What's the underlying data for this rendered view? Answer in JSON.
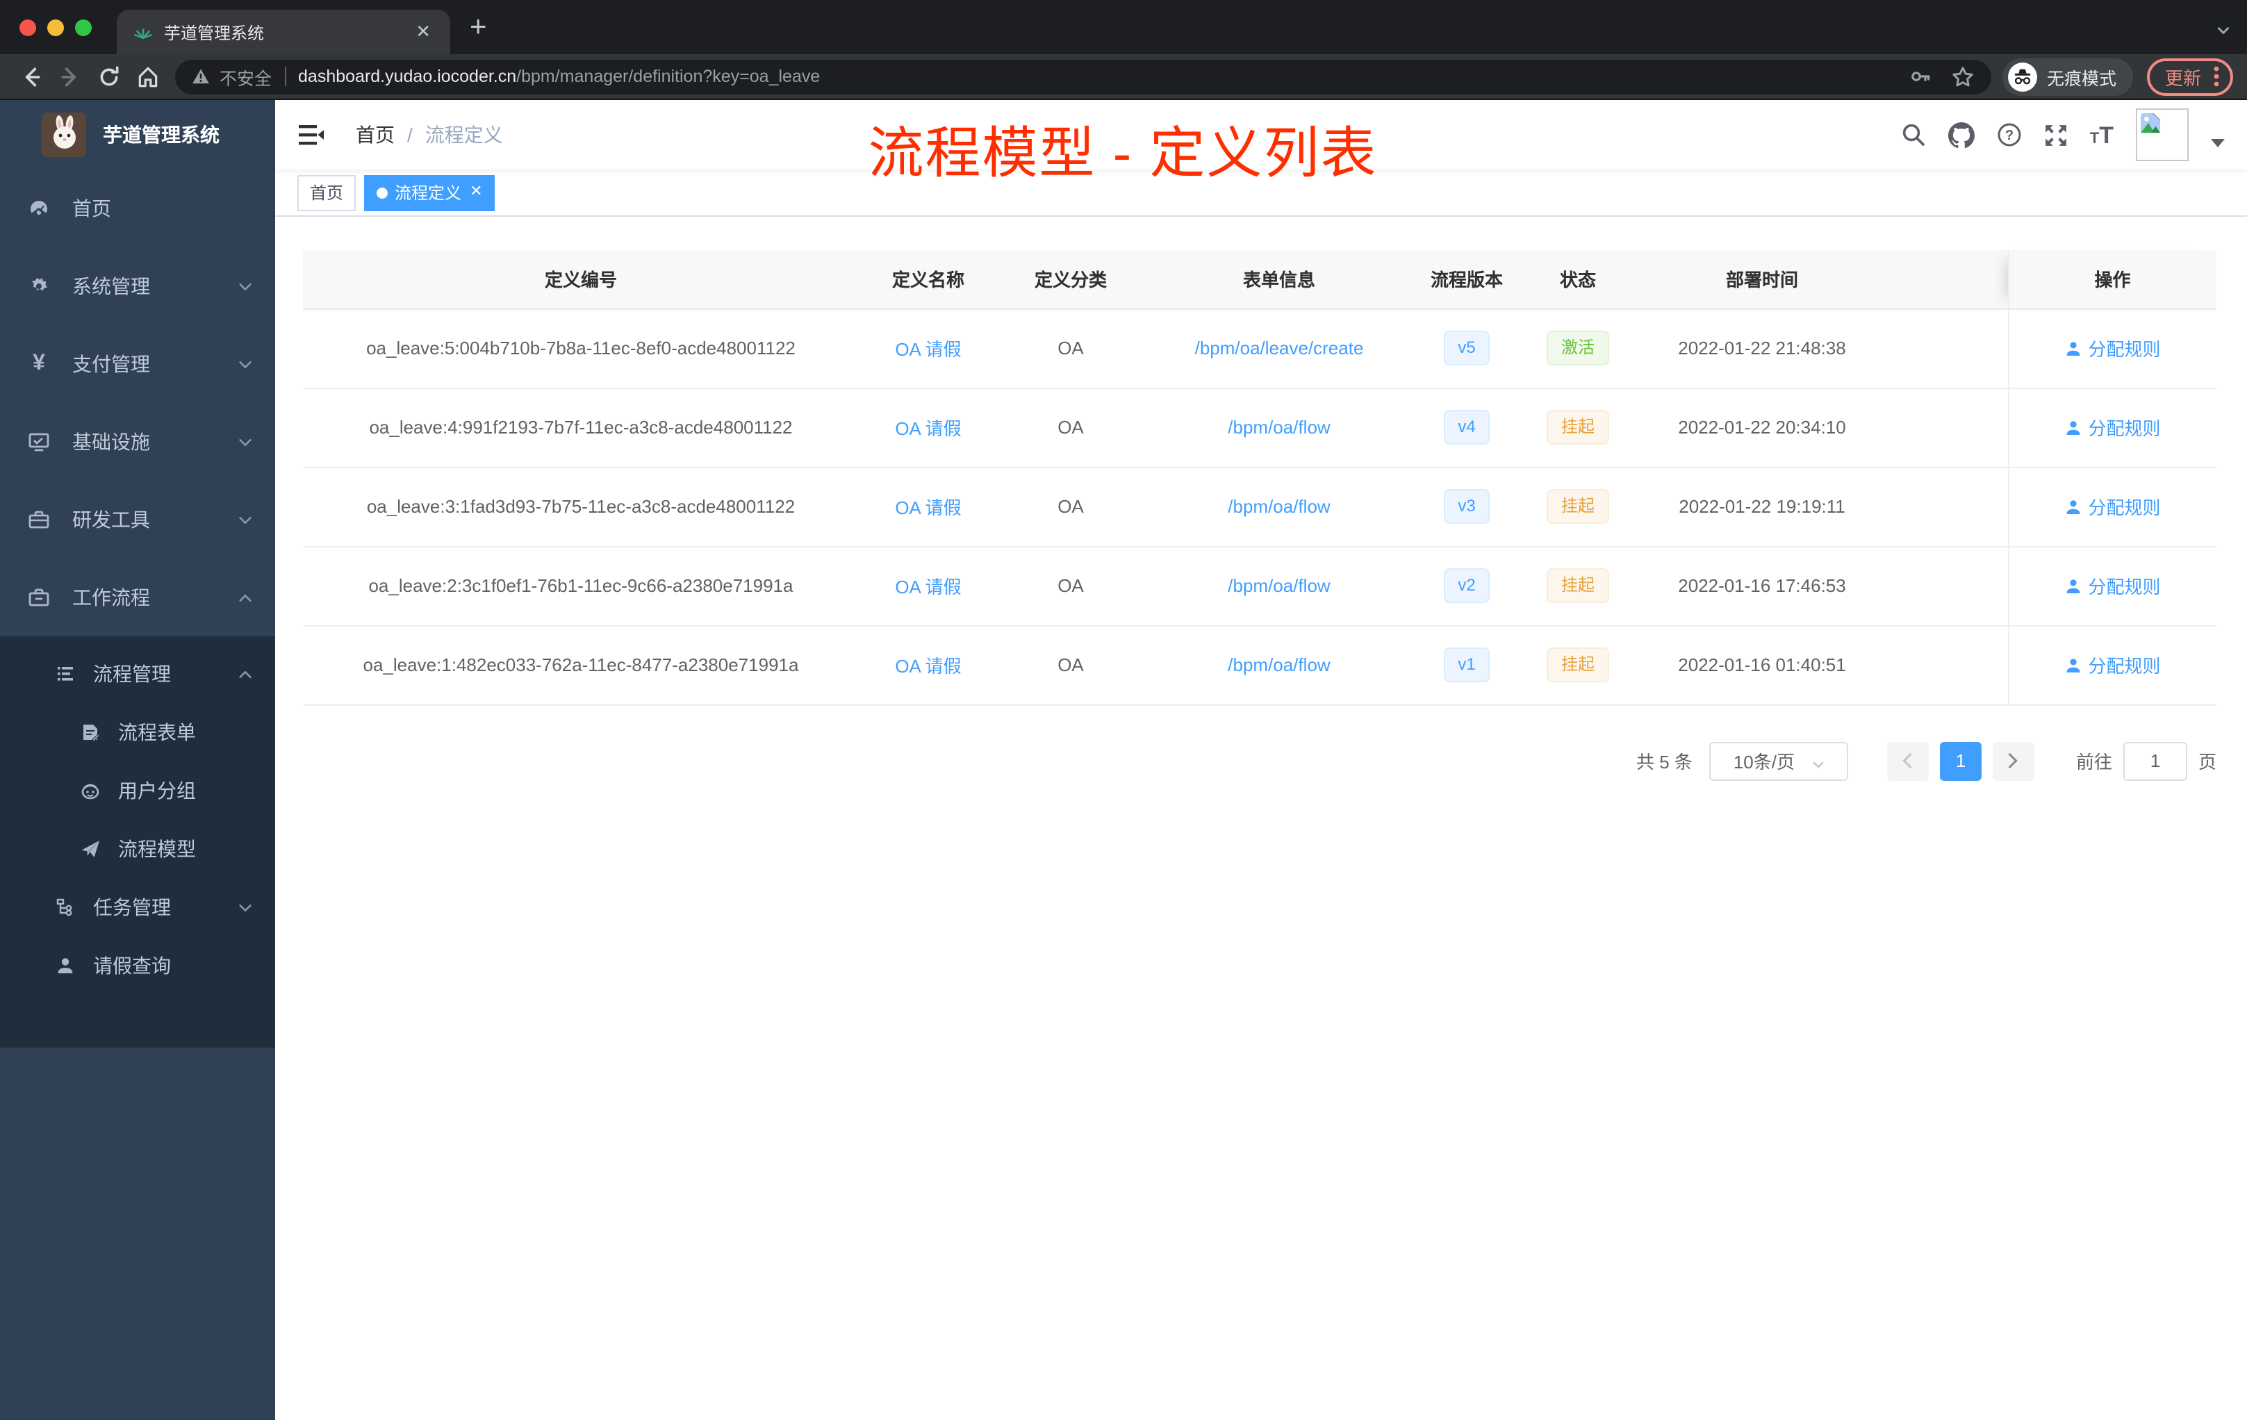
{
  "browser": {
    "tab_title": "芋道管理系统",
    "new_tab_label": "+",
    "close_tab_label": "✕",
    "security_label": "不安全",
    "url_host": "dashboard.yudao.iocoder.cn",
    "url_path": "/bpm/manager/definition?key=oa_leave",
    "incognito_label": "无痕模式",
    "update_label": "更新"
  },
  "sidebar": {
    "app_title": "芋道管理系统",
    "items": [
      {
        "label": "首页"
      },
      {
        "label": "系统管理"
      },
      {
        "label": "支付管理"
      },
      {
        "label": "基础设施"
      },
      {
        "label": "研发工具"
      },
      {
        "label": "工作流程"
      }
    ],
    "workflow_children": [
      {
        "label": "流程管理"
      },
      {
        "label": "流程表单"
      },
      {
        "label": "用户分组"
      },
      {
        "label": "流程模型"
      },
      {
        "label": "任务管理"
      },
      {
        "label": "请假查询"
      }
    ]
  },
  "navbar": {
    "breadcrumb_home": "首页",
    "breadcrumb_separator": "/",
    "breadcrumb_current": "流程定义"
  },
  "annotation": {
    "text": "流程模型 - 定义列表",
    "color": "#ff2e00"
  },
  "tags": [
    {
      "label": "首页"
    },
    {
      "label": "流程定义",
      "close": "✕"
    }
  ],
  "table": {
    "columns": [
      "定义编号",
      "定义名称",
      "定义分类",
      "表单信息",
      "流程版本",
      "状态",
      "部署时间",
      "操作"
    ],
    "rows": [
      {
        "id": "oa_leave:5:004b710b-7b8a-11ec-8ef0-acde48001122",
        "name": "OA 请假",
        "category": "OA",
        "form": "/bpm/oa/leave/create",
        "version": "v5",
        "status": "激活",
        "status_type": "st-active",
        "deploy_time": "2022-01-22 21:48:38",
        "action": "分配规则"
      },
      {
        "id": "oa_leave:4:991f2193-7b7f-11ec-a3c8-acde48001122",
        "name": "OA 请假",
        "category": "OA",
        "form": "/bpm/oa/flow",
        "version": "v4",
        "status": "挂起",
        "status_type": "st-suspend",
        "deploy_time": "2022-01-22 20:34:10",
        "action": "分配规则"
      },
      {
        "id": "oa_leave:3:1fad3d93-7b75-11ec-a3c8-acde48001122",
        "name": "OA 请假",
        "category": "OA",
        "form": "/bpm/oa/flow",
        "version": "v3",
        "status": "挂起",
        "status_type": "st-suspend",
        "deploy_time": "2022-01-22 19:19:11",
        "action": "分配规则"
      },
      {
        "id": "oa_leave:2:3c1f0ef1-76b1-11ec-9c66-a2380e71991a",
        "name": "OA 请假",
        "category": "OA",
        "form": "/bpm/oa/flow",
        "version": "v2",
        "status": "挂起",
        "status_type": "st-suspend",
        "deploy_time": "2022-01-16 17:46:53",
        "action": "分配规则"
      },
      {
        "id": "oa_leave:1:482ec033-762a-11ec-8477-a2380e71991a",
        "name": "OA 请假",
        "category": "OA",
        "form": "/bpm/oa/flow",
        "version": "v1",
        "status": "挂起",
        "status_type": "st-suspend",
        "deploy_time": "2022-01-16 01:40:51",
        "action": "分配规则"
      }
    ]
  },
  "pagination": {
    "total_label": "共 5 条",
    "page_size_value": "10条/页",
    "current_page": "1",
    "goto_label": "前往",
    "goto_value": "1",
    "page_unit": "页"
  },
  "colors": {
    "accent_blue": "#409eff",
    "status_active_green": "#67c23a",
    "status_suspend_orange": "#e6a23c",
    "annotation_red": "#ff2e00",
    "sidebar_bg": "#304156",
    "submenu_bg": "#1f2d3d"
  }
}
